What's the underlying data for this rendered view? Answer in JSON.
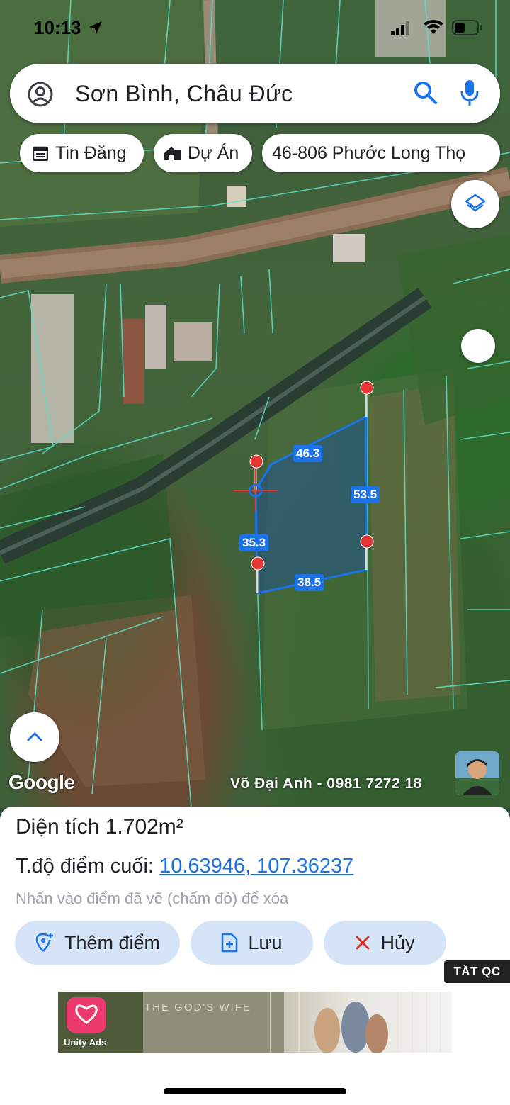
{
  "status_bar": {
    "time": "10:13"
  },
  "search": {
    "query": "Sơn Bình, Châu Đức"
  },
  "chips": [
    {
      "label": "Tin Đăng",
      "icon": "calendar-icon"
    },
    {
      "label": "Dự Án",
      "icon": "building-icon"
    },
    {
      "label": "46-806 Phước Long Thọ"
    }
  ],
  "map": {
    "attribution": "Google",
    "owner_credit": "Võ Đại Anh - 0981 7272 18",
    "parcel_edges": [
      "46.3",
      "53.5",
      "35.3",
      "38.5"
    ],
    "polygon_color": "#1a73e8",
    "marker_color": "#e53935"
  },
  "panel": {
    "area_label": "Diện tích",
    "area_value": "1.702m²",
    "coord_label": "T.độ điểm cuối:",
    "coord_value": "10.63946, 107.36237",
    "hint": "Nhấn vào điểm đã vẽ (chấm đỏ) để xóa",
    "buttons": {
      "add_point": "Thêm điểm",
      "save": "Lưu",
      "cancel": "Hủy"
    },
    "ad_tag": "TẮT QC",
    "ad": {
      "brand": "Unity Ads",
      "headline": "THE GOD'S WIFE"
    }
  }
}
